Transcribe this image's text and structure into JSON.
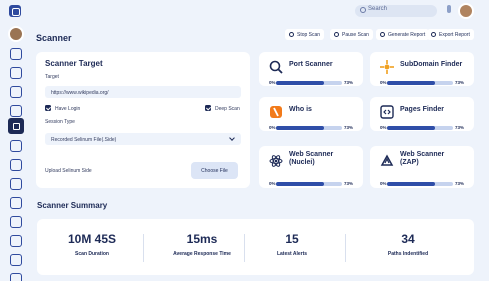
{
  "header": {
    "search_placeholder": "Search"
  },
  "page_title": "Scanner",
  "toolbar": {
    "stop": "Stop Scan",
    "pause": "Pause Scan",
    "generate": "Generate Report",
    "export": "Export Report"
  },
  "target": {
    "title": "Scanner Target",
    "target_label": "Target",
    "target_value": "https://www.wikipedia.org/",
    "have_login": "Have Login",
    "deep_scan": "Deep Scan",
    "session_label": "Session Type",
    "session_value": "Recorded Selinum File(.Side)",
    "upload_label": "Upload Selinum Side",
    "choose_file": "Choose File"
  },
  "tools": [
    {
      "name": "Port Scanner",
      "start": "0%",
      "end": "73%",
      "progress": 0.73
    },
    {
      "name": "SubDomain Finder",
      "start": "0%",
      "end": "73%",
      "progress": 0.73
    },
    {
      "name": "Who is",
      "start": "0%",
      "end": "73%",
      "progress": 0.73
    },
    {
      "name": "Pages Finder",
      "start": "0%",
      "end": "73%",
      "progress": 0.73
    },
    {
      "name_l1": "Web Scanner",
      "name_l2": "(Nuclei)",
      "start": "0%",
      "end": "73%",
      "progress": 0.73
    },
    {
      "name_l1": "Web Scanner",
      "name_l2": "(ZAP)",
      "start": "0%",
      "end": "73%",
      "progress": 0.73
    }
  ],
  "summary": {
    "title": "Scanner Summary",
    "stats": [
      {
        "value": "10M 45S",
        "label": "Scan Duration"
      },
      {
        "value": "15ms",
        "label": "Average Response Time"
      },
      {
        "value": "15",
        "label": "Latest Alerts"
      },
      {
        "value": "34",
        "label": "Paths Indentified"
      }
    ]
  },
  "colors": {
    "accent": "#2f4ea8",
    "dark": "#1d2a56",
    "bg": "#eef3fb",
    "track": "#c6d3ee"
  }
}
